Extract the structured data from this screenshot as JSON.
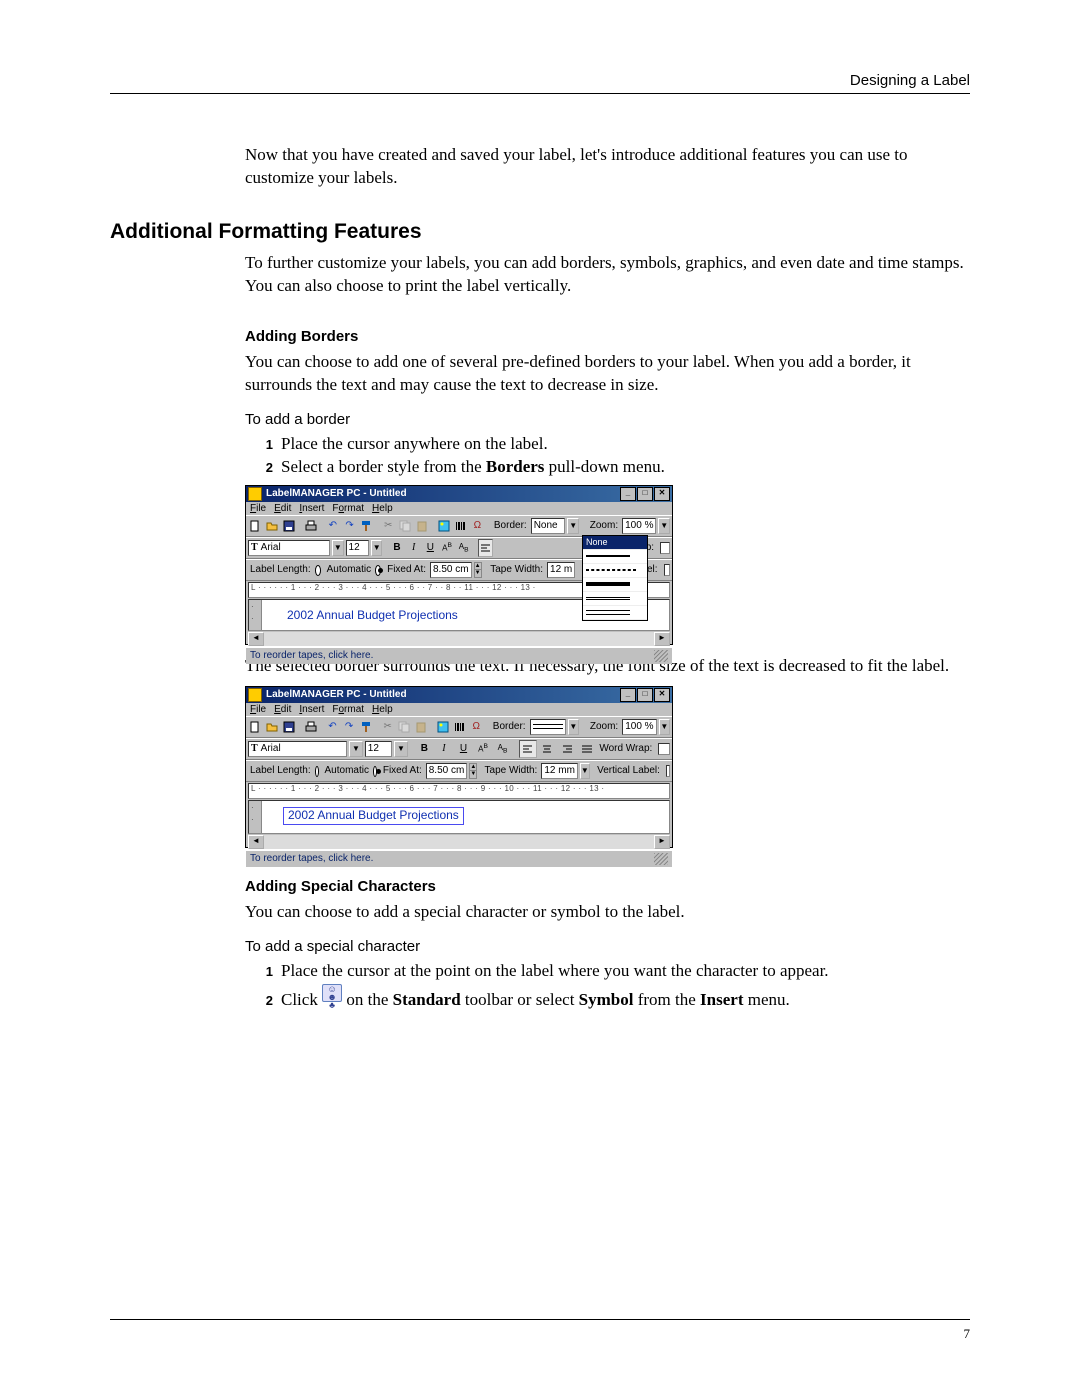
{
  "header": {
    "section_title": "Designing a Label"
  },
  "intro": "Now that you have created and saved your label, let's introduce additional features you can use to customize your labels.",
  "h1": "Additional Formatting Features",
  "p_after_h1": "To further customize your labels, you can add borders, symbols, graphics, and even date and time stamps. You can also choose to print the label vertically.",
  "borders": {
    "heading": "Adding Borders",
    "para": "You can choose to add one of several pre-defined borders to your label. When you add a border, it surrounds the text and may cause the text to decrease in size.",
    "task_title": "To add a border",
    "steps": {
      "s1": "Place the cursor anywhere on the label.",
      "s2_a": "Select a border style from the ",
      "s2_bold": "Borders",
      "s2_b": " pull-down menu."
    },
    "after_shot": "The selected border surrounds the text. If necessary, the font size of the text is decreased to fit the label."
  },
  "special": {
    "heading": "Adding Special Characters",
    "para": "You can choose to add a special character or symbol to the label.",
    "task_title": "To add a special character",
    "steps": {
      "s1": "Place the cursor at the point on the label where you want the character to appear.",
      "s2_a": "Click ",
      "s2_b": " on the ",
      "s2_bold1": "Standard",
      "s2_c": " toolbar or select ",
      "s2_bold2": "Symbol",
      "s2_d": " from the ",
      "s2_bold3": "Insert",
      "s2_e": " menu."
    }
  },
  "app": {
    "title": "LabelMANAGER PC - Untitled",
    "menus": [
      "File",
      "Edit",
      "Insert",
      "Format",
      "Help"
    ],
    "border_label": "Border:",
    "border_value_none": "None",
    "zoom_label": "Zoom:",
    "zoom_value": "100 %",
    "font_name": "Arial",
    "font_size": "12",
    "length_label": "Label Length:",
    "auto": "Automatic",
    "fixed": "Fixed At:",
    "length_val": "8.50 cm",
    "tape_label": "Tape Width:",
    "tape_val": "12 mm",
    "tape_val_cut": "12 m",
    "vert_label": "Vertical Label:",
    "vert_label_cut": "tical Label:",
    "wrap_label": "Word Wrap:",
    "ruler": "L · · · · · · 1 · · · 2 · · · 3 · · · 4 · · · 5 · · · 6 · · · 7 · · · 8 · · · 9 · · · 10 · · · 11 · · · 12 · · · 13 ·",
    "ruler_cut": "L · · · · · · 1 · · · 2 · · · 3 · · · 4 · · · 5 · · · 6 · · 7 · · 8 ·                       · 11 · · · 12 · · · 13 ·",
    "canvas_text": "2002 Annual Budget Projections",
    "status": "To reorder tapes, click here.",
    "dropdown_none": "None"
  },
  "page_number": "7"
}
